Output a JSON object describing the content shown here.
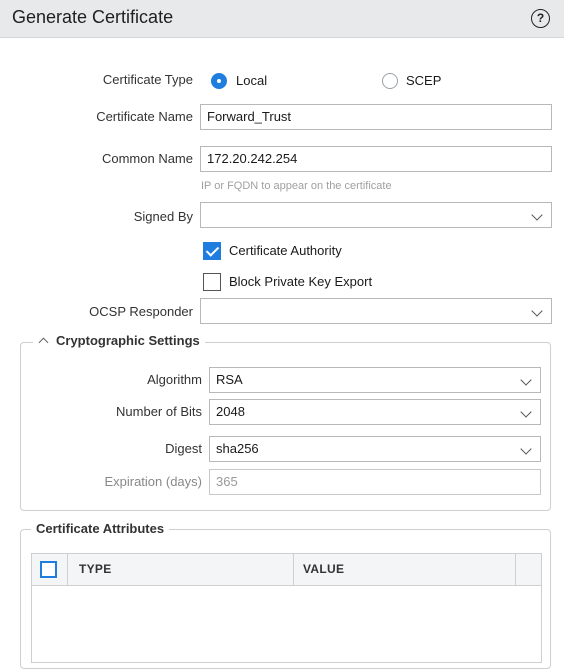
{
  "dialog": {
    "title": "Generate Certificate",
    "help_glyph": "?"
  },
  "form": {
    "certificate_type": {
      "label": "Certificate Type",
      "options": [
        "Local",
        "SCEP"
      ],
      "selected": "Local"
    },
    "certificate_name": {
      "label": "Certificate Name",
      "value": "Forward_Trust"
    },
    "common_name": {
      "label": "Common Name",
      "value": "172.20.242.254",
      "hint": "IP or FQDN to appear on the certificate"
    },
    "signed_by": {
      "label": "Signed By",
      "value": ""
    },
    "certificate_authority": {
      "label": "Certificate Authority",
      "checked": true
    },
    "block_private_key_export": {
      "label": "Block Private Key Export",
      "checked": false
    },
    "ocsp_responder": {
      "label": "OCSP Responder",
      "value": ""
    }
  },
  "crypto": {
    "legend": "Cryptographic Settings",
    "algorithm": {
      "label": "Algorithm",
      "value": "RSA"
    },
    "number_of_bits": {
      "label": "Number of Bits",
      "value": "2048"
    },
    "digest": {
      "label": "Digest",
      "value": "sha256"
    },
    "expiration": {
      "label": "Expiration (days)",
      "value": "365"
    }
  },
  "attributes": {
    "legend": "Certificate Attributes",
    "columns": [
      "TYPE",
      "VALUE"
    ]
  },
  "colors": {
    "accent": "#1f7ddf",
    "title_bar": "#e8e9ea",
    "hint_text": "#a0a0a0"
  },
  "icons": [
    "help-icon",
    "chevron-down-icon",
    "collapse-chevron-icon",
    "checkmark-icon"
  ]
}
